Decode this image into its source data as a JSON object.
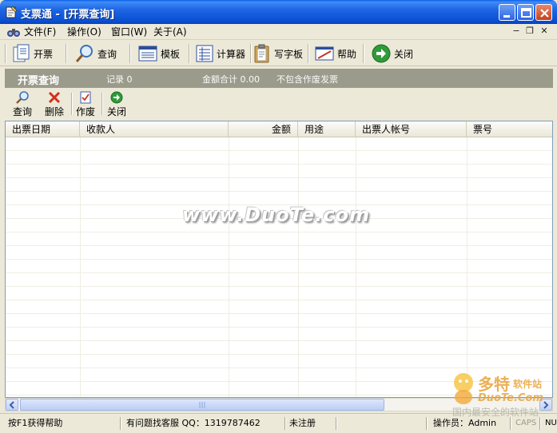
{
  "window": {
    "title": "支票通 - [开票查询]"
  },
  "menu": {
    "items": [
      {
        "label": "文件(F)"
      },
      {
        "label": "操作(O)"
      },
      {
        "label": "窗口(W)"
      },
      {
        "label": "关于(A)"
      }
    ],
    "mdi_buttons": [
      "−",
      "❐",
      "✕"
    ]
  },
  "toolbar": {
    "items": [
      {
        "label": "开票",
        "icon": "document-icon"
      },
      {
        "label": "查询",
        "icon": "magnifier-icon"
      },
      {
        "label": "模板",
        "icon": "template-icon"
      },
      {
        "label": "计算器",
        "icon": "calculator-icon"
      },
      {
        "label": "写字板",
        "icon": "clipboard-icon"
      },
      {
        "label": "帮助",
        "icon": "help-icon"
      },
      {
        "label": "关闭",
        "icon": "exit-arrow-icon"
      }
    ]
  },
  "header": {
    "title": "开票查询",
    "records_text": "记录 0",
    "total_text": "金额合计 0.00",
    "note_text": "不包含作废发票"
  },
  "subtoolbar": {
    "items": [
      {
        "label": "查询",
        "icon": "magnifier-icon"
      },
      {
        "label": "删除",
        "icon": "delete-x-icon"
      },
      {
        "label": "作废",
        "icon": "void-document-icon"
      },
      {
        "label": "关闭",
        "icon": "exit-arrow-icon"
      }
    ]
  },
  "table": {
    "columns": [
      "出票日期",
      "收款人",
      "金额",
      "用途",
      "出票人帐号",
      "票号"
    ],
    "rows": []
  },
  "watermark": "www.DuoTe.com",
  "statusbar": {
    "help": "按F1获得帮助",
    "support": "有问题找客服 QQ：1319787462",
    "registration": "未注册",
    "operator": "操作员：Admin",
    "caps": "CAPS",
    "num": "NUM"
  },
  "brand": {
    "name": "多特",
    "sub": "软件站",
    "url": "DuoTe.Com",
    "slogan": "国内最安全的软件站"
  },
  "colors": {
    "titlebar": "#0A4FD2",
    "header_band": "#9B9B8C",
    "window_bg": "#ECE9D8"
  }
}
